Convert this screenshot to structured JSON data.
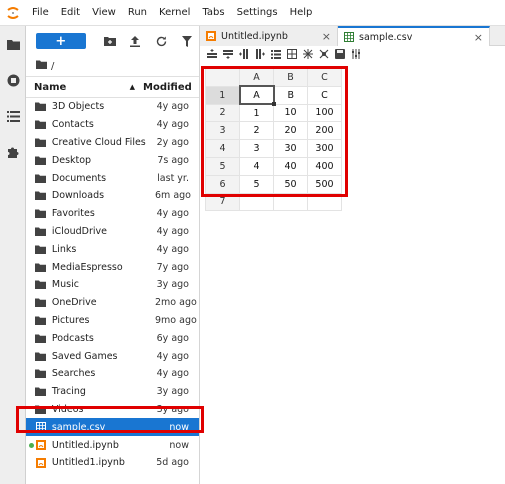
{
  "menu": [
    "File",
    "Edit",
    "View",
    "Run",
    "Kernel",
    "Tabs",
    "Settings",
    "Help"
  ],
  "browser": {
    "new_label": "+",
    "breadcrumb": "/",
    "col_name": "Name",
    "col_modified": "Modified",
    "files": [
      {
        "name": "3D Objects",
        "modified": "4y ago",
        "type": "folder"
      },
      {
        "name": "Contacts",
        "modified": "4y ago",
        "type": "folder"
      },
      {
        "name": "Creative Cloud Files",
        "modified": "2y ago",
        "type": "folder"
      },
      {
        "name": "Desktop",
        "modified": "7s ago",
        "type": "folder"
      },
      {
        "name": "Documents",
        "modified": "last yr.",
        "type": "folder"
      },
      {
        "name": "Downloads",
        "modified": "6m ago",
        "type": "folder"
      },
      {
        "name": "Favorites",
        "modified": "4y ago",
        "type": "folder"
      },
      {
        "name": "iCloudDrive",
        "modified": "4y ago",
        "type": "folder"
      },
      {
        "name": "Links",
        "modified": "4y ago",
        "type": "folder"
      },
      {
        "name": "MediaEspresso",
        "modified": "7y ago",
        "type": "folder"
      },
      {
        "name": "Music",
        "modified": "3y ago",
        "type": "folder"
      },
      {
        "name": "OneDrive",
        "modified": "2mo ago",
        "type": "folder"
      },
      {
        "name": "Pictures",
        "modified": "9mo ago",
        "type": "folder"
      },
      {
        "name": "Podcasts",
        "modified": "6y ago",
        "type": "folder"
      },
      {
        "name": "Saved Games",
        "modified": "4y ago",
        "type": "folder"
      },
      {
        "name": "Searches",
        "modified": "4y ago",
        "type": "folder"
      },
      {
        "name": "Tracing",
        "modified": "3y ago",
        "type": "folder"
      },
      {
        "name": "Videos",
        "modified": "3y ago",
        "type": "folder"
      },
      {
        "name": "sample.csv",
        "modified": "now",
        "type": "csv",
        "selected": true
      },
      {
        "name": "Untitled.ipynb",
        "modified": "now",
        "type": "notebook",
        "running": true
      },
      {
        "name": "Untitled1.ipynb",
        "modified": "5d ago",
        "type": "notebook"
      }
    ]
  },
  "tabs": [
    {
      "label": "Untitled.ipynb",
      "close": "×",
      "active": false
    },
    {
      "label": "sample.csv",
      "close": "×",
      "active": true
    }
  ],
  "grid": {
    "col_headers": [
      "A",
      "B",
      "C"
    ],
    "row_headers": [
      "1",
      "2",
      "3",
      "4",
      "5",
      "6",
      "7"
    ],
    "rows": [
      [
        "A",
        "B",
        "C"
      ],
      [
        "1",
        "10",
        "100"
      ],
      [
        "2",
        "20",
        "200"
      ],
      [
        "3",
        "30",
        "300"
      ],
      [
        "4",
        "40",
        "400"
      ],
      [
        "5",
        "50",
        "500"
      ],
      [
        "",
        "",
        ""
      ]
    ]
  },
  "colors": {
    "accent": "#1976d2",
    "highlight": "#e00000",
    "notebook": "#f57c00",
    "running": "#4caf50"
  }
}
